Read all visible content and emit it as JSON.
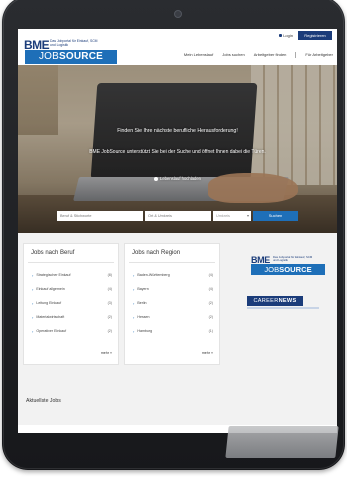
{
  "header": {
    "logo": {
      "bme": "BME",
      "bme_sub": "Das Jobportal für Einkauf, SCM und Logistik",
      "jobsource_prefix": "JOB",
      "jobsource_suffix": "SOURCE"
    },
    "login_label": "Login",
    "register_label": "Registrieren",
    "nav": [
      "Mein Lebenslauf",
      "Jobs suchen",
      "Arbeitgeber finden",
      "Für Arbeitgeber"
    ]
  },
  "hero": {
    "title": "Finden Sie Ihre nächste berufliche Herausforderung!",
    "subtitle": "BME JobSource unterstützt Sie bei der Suche und öffnet Ihnen dabei die Türen.",
    "cv_link": "Lebenslauf hochladen",
    "search": {
      "keyword_placeholder": "Beruf & Stichworte",
      "location_placeholder": "Ort & Umkreis",
      "radius_placeholder": "Umkreis",
      "button_label": "Suchen"
    }
  },
  "jobs_by_profession": {
    "title": "Jobs nach Beruf",
    "items": [
      {
        "label": "Strategischer Einkauf",
        "count": "(8)"
      },
      {
        "label": "Einkauf allgemein",
        "count": "(4)"
      },
      {
        "label": "Leitung Einkauf",
        "count": "(3)"
      },
      {
        "label": "Materialwirtschaft",
        "count": "(2)"
      },
      {
        "label": "Operativer Einkauf",
        "count": "(2)"
      }
    ],
    "more_label": "mehr »"
  },
  "jobs_by_region": {
    "title": "Jobs nach Region",
    "items": [
      {
        "label": "Baden-Württemberg",
        "count": "(4)"
      },
      {
        "label": "Bayern",
        "count": "(4)"
      },
      {
        "label": "Berlin",
        "count": "(2)"
      },
      {
        "label": "Hessen",
        "count": "(2)"
      },
      {
        "label": "Hamburg",
        "count": "(1)"
      }
    ],
    "more_label": "mehr »"
  },
  "sidebar": {
    "logo": {
      "bme": "BME",
      "bme_sub": "Das Jobportal für Einkauf, SCM und Logistik",
      "jobsource_prefix": "JOB",
      "jobsource_suffix": "SOURCE"
    },
    "career_news_prefix": "CAREER",
    "career_news_suffix": "NEWS"
  },
  "latest_jobs_title": "Aktuellste Jobs",
  "colors": {
    "brand_dark": "#1b3c7a",
    "brand_blue": "#1e6fb8"
  }
}
